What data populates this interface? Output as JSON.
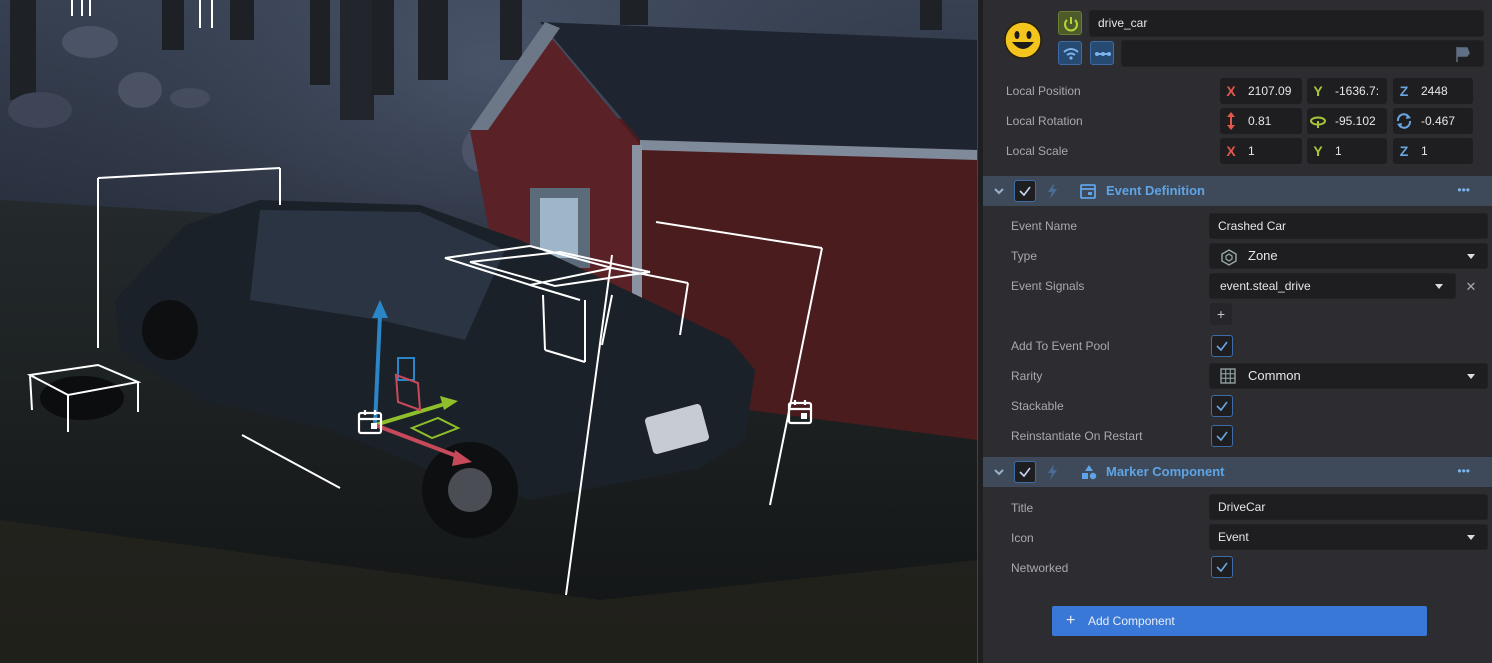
{
  "entity": {
    "name": "drive_car",
    "secondary_value": ""
  },
  "transform": {
    "position_label": "Local Position",
    "rotation_label": "Local Rotation",
    "scale_label": "Local Scale",
    "position": {
      "x": "2107.09",
      "y": "-1636.7:",
      "z": "2448"
    },
    "rotation": {
      "a": "0.81",
      "b": "-95.102",
      "c": "-0.467"
    },
    "scale": {
      "x": "1",
      "y": "1",
      "z": "1"
    },
    "axis_x": "X",
    "axis_y": "Y",
    "axis_z": "Z"
  },
  "event_definition": {
    "title": "Event Definition",
    "more": "•••",
    "event_name_label": "Event Name",
    "event_name": "Crashed Car",
    "type_label": "Type",
    "type": "Zone",
    "signals_label": "Event Signals",
    "signal": "event.steal_drive",
    "remove_glyph": "✕",
    "add_glyph": "+",
    "pool_label": "Add To Event Pool",
    "pool_checked": true,
    "rarity_label": "Rarity",
    "rarity": "Common",
    "stackable_label": "Stackable",
    "stackable_checked": true,
    "reinstantiate_label": "Reinstantiate On Restart",
    "reinstantiate_checked": true
  },
  "marker": {
    "title": "Marker Component",
    "more": "•••",
    "title_label": "Title",
    "title_value": "DriveCar",
    "icon_label": "Icon",
    "icon_value": "Event",
    "networked_label": "Networked",
    "networked_checked": true
  },
  "add_component": {
    "plus": "+",
    "label": "Add Component"
  },
  "colors": {
    "accent": "#3a78d8",
    "section_header": "#3e4a5a",
    "section_title": "#5fa4e6",
    "panel_bg": "#2d2d31",
    "field_bg": "#1e1e21",
    "axis_x": "#e4574b",
    "axis_y": "#a8c53a",
    "axis_z": "#6aa5e0"
  },
  "icons": [
    "smiley-face-icon",
    "power-icon",
    "wifi-icon",
    "dots-icon",
    "flag-icon",
    "chevron-down-icon",
    "check-icon",
    "lightning-icon",
    "calendar-icon",
    "zone-icon",
    "grid-icon",
    "marker-icon",
    "scale-arrows-icon",
    "rotate-icon",
    "refresh-icon",
    "event-calendar-icon"
  ]
}
